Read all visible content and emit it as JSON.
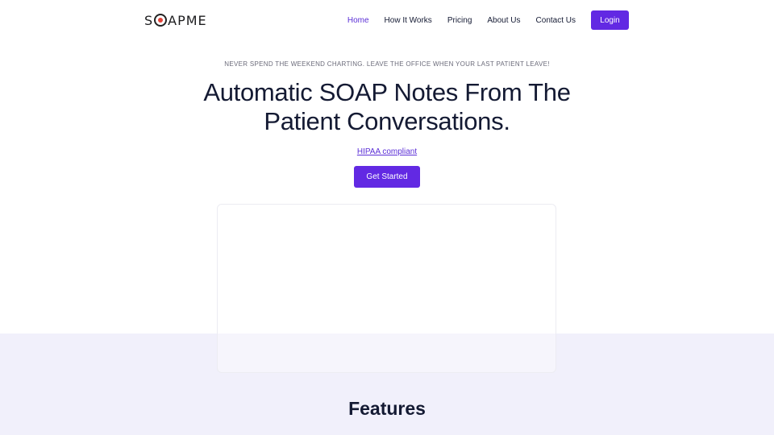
{
  "header": {
    "logo": {
      "prefix": "S",
      "suffix": "APME"
    },
    "nav": [
      {
        "label": "Home",
        "active": true
      },
      {
        "label": "How It Works",
        "active": false
      },
      {
        "label": "Pricing",
        "active": false
      },
      {
        "label": "About Us",
        "active": false
      },
      {
        "label": "Contact Us",
        "active": false
      }
    ],
    "login_label": "Login"
  },
  "hero": {
    "tagline": "NEVER SPEND THE WEEKEND CHARTING. LEAVE THE OFFICE WHEN YOUR LAST PATIENT LEAVE!",
    "headline_line1": "Automatic SOAP Notes From The",
    "headline_line2": "Patient Conversations.",
    "hipaa_link": "HIPAA compliant",
    "cta_label": "Get Started"
  },
  "features": {
    "title": "Features"
  },
  "colors": {
    "accent": "#6229e3",
    "active_nav": "#5b2fd6",
    "logo_dot": "#e2443a",
    "band_bg": "#f1f0fb",
    "text": "#141a33"
  }
}
